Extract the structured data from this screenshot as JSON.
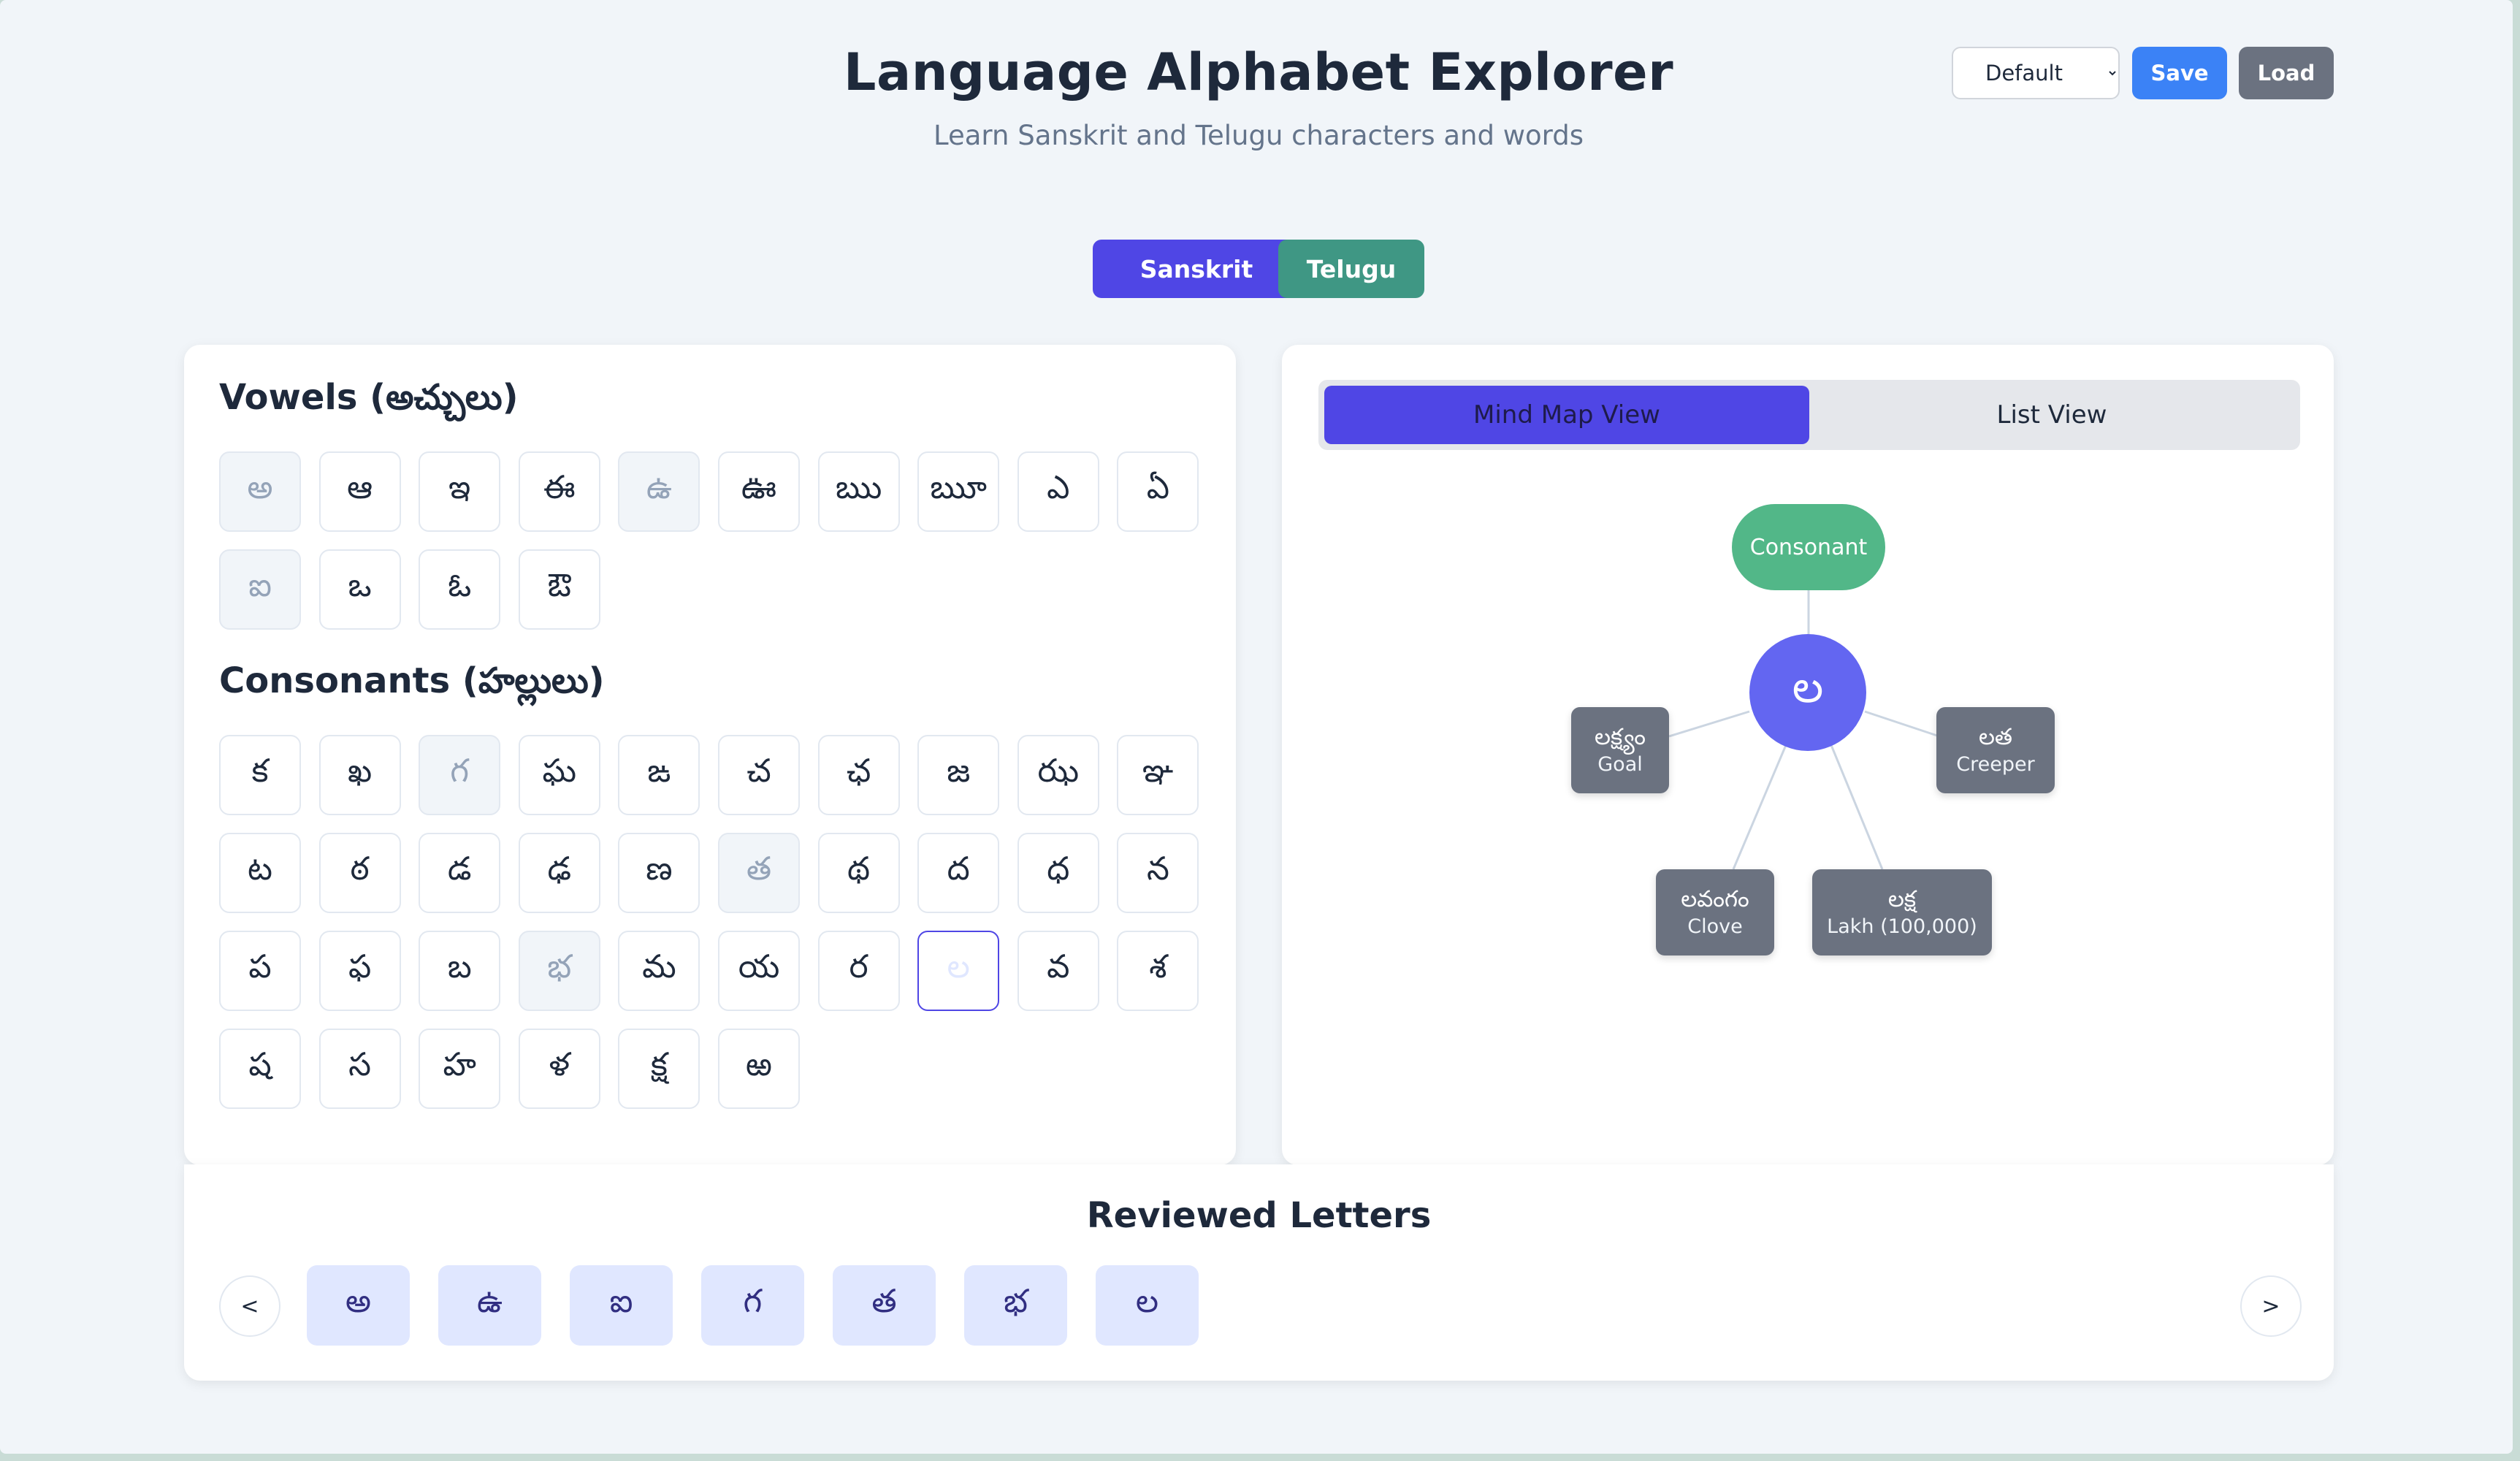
{
  "header": {
    "title": "Language Alphabet Explorer",
    "subtitle": "Learn Sanskrit and Telugu characters and words",
    "profile_select": "Default",
    "save_label": "Save",
    "load_label": "Load"
  },
  "languages": {
    "sanskrit_label": "Sanskrit",
    "telugu_label": "Telugu",
    "active": "Sanskrit"
  },
  "vowels": {
    "heading": "Vowels (అచ్చులు)",
    "letters": [
      "అ",
      "ఆ",
      "ఇ",
      "ఈ",
      "ఉ",
      "ఊ",
      "ఋ",
      "ౠ",
      "ఎ",
      "ఏ",
      "ఐ",
      "ఒ",
      "ఓ",
      "ఔ"
    ],
    "reviewed": [
      "అ",
      "ఉ",
      "ఐ"
    ]
  },
  "consonants": {
    "heading": "Consonants (హల్లులు)",
    "letters": [
      "క",
      "ఖ",
      "గ",
      "ఘ",
      "ఙ",
      "చ",
      "ఛ",
      "జ",
      "ఝ",
      "ఞ",
      "ట",
      "ఠ",
      "డ",
      "ఢ",
      "ణ",
      "త",
      "థ",
      "ద",
      "ధ",
      "న",
      "ప",
      "ఫ",
      "బ",
      "భ",
      "మ",
      "య",
      "ర",
      "ల",
      "వ",
      "శ",
      "ష",
      "స",
      "హ",
      "ళ",
      "క్ష",
      "ఱ"
    ],
    "reviewed": [
      "గ",
      "త",
      "భ"
    ],
    "selected": "ల"
  },
  "view_tabs": {
    "mind_map": "Mind Map View",
    "list": "List View",
    "active": "Mind Map View"
  },
  "mind_map": {
    "type_label": "Consonant",
    "center_letter": "ల",
    "words": [
      {
        "word": "లక్ష్యం",
        "meaning": "Goal"
      },
      {
        "word": "లత",
        "meaning": "Creeper"
      },
      {
        "word": "లవంగం",
        "meaning": "Clove"
      },
      {
        "word": "లక్ష",
        "meaning": "Lakh (100,000)"
      }
    ]
  },
  "reviewed_section": {
    "title": "Reviewed Letters",
    "prev_label": "<",
    "next_label": ">",
    "letters": [
      "అ",
      "ఉ",
      "ఐ",
      "గ",
      "త",
      "భ",
      "ల"
    ]
  },
  "colors": {
    "primary": "#4f46e5",
    "telugu": "#3f9784",
    "save": "#3b82f6",
    "load": "#6b7280",
    "type_node": "#52b788",
    "center_node": "#6366f1"
  }
}
